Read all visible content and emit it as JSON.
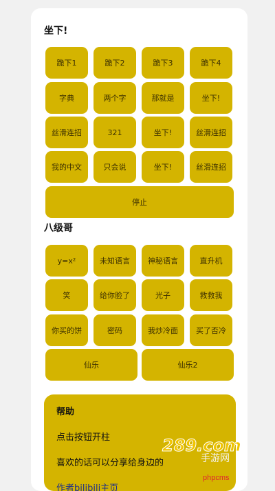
{
  "colors": {
    "background": "#f1f1f1",
    "card": "#ffffff",
    "button": "#d4b400",
    "button_text": "#3c3000",
    "link": "#1d2f8a",
    "watermark": "#e0262f"
  },
  "section1": {
    "title": "坐下!",
    "rows": [
      [
        "跪下1",
        "跪下2",
        "跪下3",
        "跪下4"
      ],
      [
        "字典",
        "两个字",
        "那就是",
        "坐下!"
      ],
      [
        "丝滑连招",
        "321",
        "坐下!",
        "丝滑连招"
      ],
      [
        "我的中文",
        "只会说",
        "坐下!",
        "丝滑连招"
      ]
    ],
    "stop_label": "停止"
  },
  "section2": {
    "title": "八级哥",
    "rows": [
      [
        "y=x²",
        "未知语言",
        "神秘语言",
        "直升机"
      ],
      [
        "笑",
        "给你脸了",
        "光子",
        "救救我"
      ],
      [
        "你买的饼",
        "密码",
        "我炒冷面",
        "买了否冷"
      ]
    ],
    "pair": [
      "仙乐",
      "仙乐2"
    ]
  },
  "help": {
    "title": "帮助",
    "line1": "点击按钮开柱",
    "line2": "喜欢的话可以分享给身边的",
    "link": "作者bilibili主页"
  },
  "watermark": {
    "logo_text": "289.com",
    "sub_text": "手游网",
    "site": "phpcms"
  }
}
